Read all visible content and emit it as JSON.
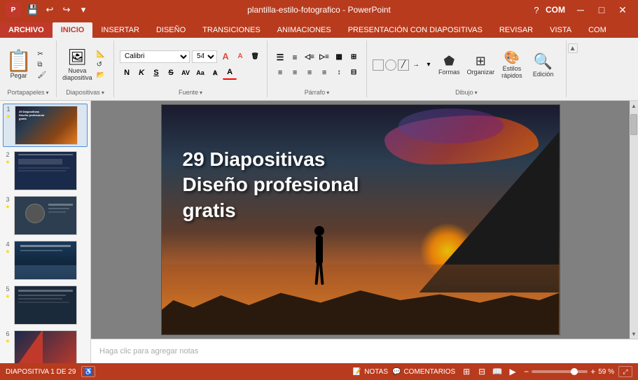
{
  "titlebar": {
    "title": "plantilla-estilo-fotografico - PowerPoint",
    "min_label": "─",
    "max_label": "□",
    "close_label": "✕",
    "help_label": "?",
    "com_label": "COM"
  },
  "ribbon": {
    "tabs": [
      {
        "id": "archivo",
        "label": "ARCHIVO",
        "active": false,
        "archivo": true
      },
      {
        "id": "inicio",
        "label": "INICIO",
        "active": true
      },
      {
        "id": "insertar",
        "label": "INSERTAR",
        "active": false
      },
      {
        "id": "disenio",
        "label": "DISEÑO",
        "active": false
      },
      {
        "id": "transiciones",
        "label": "TRANSICIONES",
        "active": false
      },
      {
        "id": "animaciones",
        "label": "ANIMACIONES",
        "active": false
      },
      {
        "id": "presentacion",
        "label": "PRESENTACIÓN CON DIAPOSITIVAS",
        "active": false
      },
      {
        "id": "revisar",
        "label": "REVISAR",
        "active": false
      },
      {
        "id": "vista",
        "label": "VISTA",
        "active": false
      },
      {
        "id": "com",
        "label": "COM",
        "active": false
      }
    ],
    "groups": {
      "portapapeles": {
        "label": "Portapapeles",
        "pegar": "Pegar",
        "cortar": "✂",
        "copiar": "⧉",
        "copiar_formato": "🖌"
      },
      "diapositivas": {
        "label": "Diapositivas",
        "nueva": "Nueva\ndiapositiva"
      },
      "fuente": {
        "label": "Fuente",
        "font_name": "Calibri",
        "font_size": "54",
        "bold": "N",
        "italic": "K",
        "underline": "S",
        "strikethrough": "S̶",
        "increase": "A",
        "decrease": "A",
        "clear": "abc",
        "spacing": "AV",
        "case": "Aa",
        "color": "A"
      },
      "parrafo": {
        "label": "Párrafo",
        "bullets": "☰",
        "numbering": "≡",
        "decrease_indent": "◁",
        "increase_indent": "▷",
        "columns": "▦",
        "align_left": "≡",
        "center": "≡",
        "align_right": "≡",
        "justify": "≡",
        "line_spacing": "↕",
        "direction": "⇄"
      },
      "dibujo": {
        "label": "Dibujo",
        "formas": "Formas",
        "organizar": "Organizar",
        "estilos": "Estilos\nrápidos",
        "edicion": "Edición"
      }
    }
  },
  "slides": [
    {
      "num": "1",
      "starred": true,
      "active": true,
      "thumb_class": "thumb-img-1",
      "text": "29 Diapositivas Diseño profesional gratis"
    },
    {
      "num": "2",
      "starred": true,
      "active": false,
      "thumb_class": "slide-thumb-2",
      "text": ""
    },
    {
      "num": "3",
      "starred": true,
      "active": false,
      "thumb_class": "slide-thumb-3",
      "text": ""
    },
    {
      "num": "4",
      "starred": true,
      "active": false,
      "thumb_class": "slide-thumb-4",
      "text": ""
    },
    {
      "num": "5",
      "starred": true,
      "active": false,
      "thumb_class": "slide-thumb-5",
      "text": ""
    },
    {
      "num": "6",
      "starred": true,
      "active": false,
      "thumb_class": "slide-thumb-6",
      "text": ""
    }
  ],
  "slide_content": {
    "title_line1": "29 Diapositivas",
    "title_line2": "Diseño profesional",
    "title_line3": "gratis"
  },
  "notes": {
    "placeholder": "Haga clic para agregar notas"
  },
  "statusbar": {
    "slide_info": "DIAPOSITIVA 1 DE 29",
    "notas": "NOTAS",
    "comentarios": "COMENTARIOS",
    "zoom": "59 %"
  }
}
